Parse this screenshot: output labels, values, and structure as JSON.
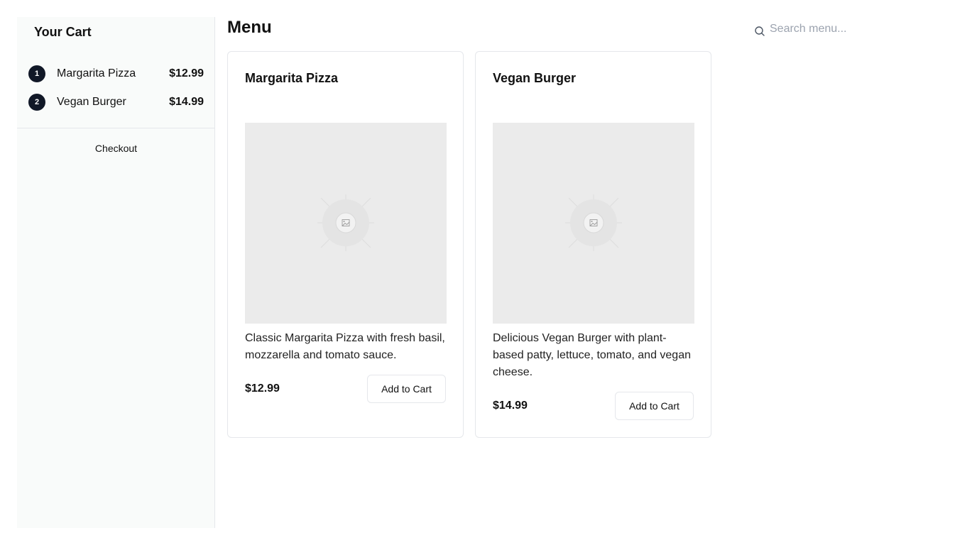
{
  "cart": {
    "title": "Your Cart",
    "items": [
      {
        "num": "1",
        "name": "Margarita Pizza",
        "price": "$12.99"
      },
      {
        "num": "2",
        "name": "Vegan Burger",
        "price": "$14.99"
      }
    ],
    "checkout_label": "Checkout"
  },
  "header": {
    "title": "Menu",
    "search_placeholder": "Search menu..."
  },
  "menu": {
    "items": [
      {
        "name": "Margarita Pizza",
        "description": "Classic Margarita Pizza with fresh basil, mozzarella and tomato sauce.",
        "price": "$12.99",
        "button_label": "Add to Cart"
      },
      {
        "name": "Vegan Burger",
        "description": "Delicious Vegan Burger with plant-based patty, lettuce, tomato, and vegan cheese.",
        "price": "$14.99",
        "button_label": "Add to Cart"
      }
    ]
  },
  "icons": {
    "search": "search-icon",
    "image_placeholder": "image-placeholder-icon"
  },
  "colors": {
    "badge_bg": "#111827",
    "sidebar_bg": "#f9fbfa",
    "image_placeholder_bg": "#ebebeb",
    "border": "#e5e7eb"
  }
}
